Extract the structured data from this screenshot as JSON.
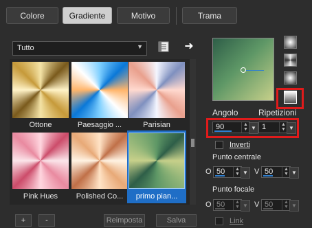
{
  "tabs": [
    "Colore",
    "Gradiente",
    "Motivo",
    "Trama"
  ],
  "active_tab": "Gradiente",
  "category_select": {
    "value": "Tutto"
  },
  "gradients": [
    {
      "name": "Ottone",
      "colors": [
        "#7a5a1c",
        "#f4e3a6",
        "#c69a3a",
        "#fff3c8"
      ]
    },
    {
      "name": "Paesaggio ...",
      "colors": [
        "#0a78d8",
        "#7fd0ff",
        "#ffffff",
        "#ffb56b"
      ]
    },
    {
      "name": "Parisian",
      "colors": [
        "#7f90bf",
        "#f4f6ff",
        "#e9a08d",
        "#ffd9cf"
      ]
    },
    {
      "name": "Pink Hues",
      "colors": [
        "#cc4c6a",
        "#ffd6df",
        "#e98aa0",
        "#fbe5ea"
      ]
    },
    {
      "name": "Polished Co...",
      "colors": [
        "#c07048",
        "#ffe3c6",
        "#e8a977",
        "#fff3e3"
      ]
    },
    {
      "name": "primo pian...",
      "colors": [
        "#2e5e48",
        "#5e9766",
        "#8cb276",
        "#c7d08a"
      ]
    }
  ],
  "selected_gradient": "primo pian...",
  "angolo": {
    "label": "Angolo",
    "value": "90"
  },
  "ripetizioni": {
    "label": "Ripetizioni",
    "value": "1"
  },
  "inverti": {
    "label": "Inverti",
    "checked": false
  },
  "punto_centrale": {
    "label": "Punto centrale",
    "o_label": "O",
    "v_label": "V",
    "o_value": "50",
    "v_value": "50"
  },
  "punto_focale": {
    "label": "Punto focale",
    "o_label": "O",
    "v_label": "V",
    "o_value": "50",
    "v_value": "50"
  },
  "link": {
    "label": "Link",
    "checked": false
  },
  "buttons": {
    "add": "+",
    "remove": "-",
    "reset": "Reimposta",
    "save": "Salva"
  },
  "highlight_color": "#e01b1b",
  "accent_color": "#2f7fd0"
}
